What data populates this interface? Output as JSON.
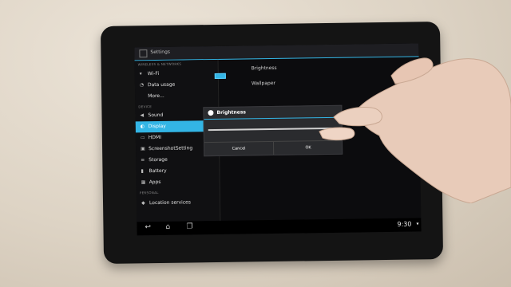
{
  "app": {
    "title": "Settings"
  },
  "sidebar": {
    "section_wireless": "WIRELESS & NETWORKS",
    "items": [
      {
        "label": "Wi-Fi",
        "icon": "wifi-icon"
      },
      {
        "label": "Data usage",
        "icon": "data-icon"
      },
      {
        "label": "More...",
        "icon": ""
      },
      {
        "label": "Sound",
        "icon": "sound-icon"
      },
      {
        "label": "Display",
        "icon": "display-icon"
      },
      {
        "label": "HDMI",
        "icon": "hdmi-icon"
      },
      {
        "label": "ScreenshotSetting",
        "icon": "screenshot-icon"
      },
      {
        "label": "Storage",
        "icon": "storage-icon"
      },
      {
        "label": "Battery",
        "icon": "battery-icon"
      },
      {
        "label": "Apps",
        "icon": "apps-icon"
      },
      {
        "label": "Location services",
        "icon": "location-icon"
      }
    ],
    "section_device": "DEVICE",
    "section_personal": "PERSONAL"
  },
  "detail": {
    "brightness_label": "Brightness",
    "wallpaper_label": "Wallpaper"
  },
  "dialog": {
    "title": "Brightness",
    "cancel_label": "Cancel",
    "ok_label": "OK"
  },
  "statusbar": {
    "time": "9:30"
  },
  "colors": {
    "accent": "#33b5e5"
  }
}
